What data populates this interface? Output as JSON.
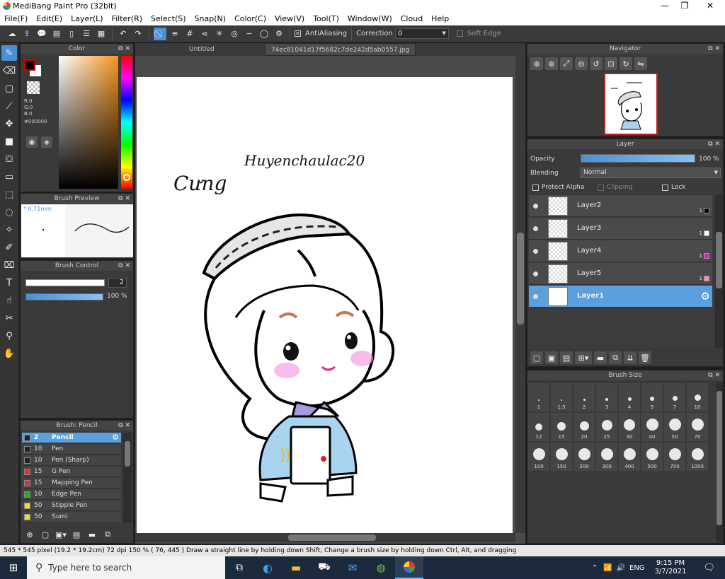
{
  "window": {
    "title": "MediBang Paint Pro (32bit)",
    "minimize": "—",
    "maximize": "❐",
    "close": "✕"
  },
  "menu": [
    "File(F)",
    "Edit(E)",
    "Layer(L)",
    "Filter(R)",
    "Select(S)",
    "Snap(N)",
    "Color(C)",
    "View(V)",
    "Tool(T)",
    "Window(W)",
    "Cloud",
    "Help"
  ],
  "toolbar": {
    "antialiasing": "AntiAliasing",
    "correction_label": "Correction",
    "correction_value": "0",
    "soft_edge": "Soft Edge"
  },
  "color_panel": {
    "title": "Color",
    "r": "R:0",
    "g": "G:0",
    "b": "B:0",
    "hex": "#000000"
  },
  "brush_preview": {
    "title": "Brush Preview",
    "size": "* 0.71mm"
  },
  "brush_control": {
    "title": "Brush Control",
    "size_value": "2",
    "opacity_value": "100 %"
  },
  "brush_list": {
    "title": "Brush: Pencil",
    "items": [
      {
        "size": "2",
        "name": "Pencil",
        "color": "#222222"
      },
      {
        "size": "10",
        "name": "Pen",
        "color": "#222222"
      },
      {
        "size": "10",
        "name": "Pen (Sharp)",
        "color": "#222222"
      },
      {
        "size": "15",
        "name": "G Pen",
        "color": "#e03030"
      },
      {
        "size": "15",
        "name": "Mapping Pen",
        "color": "#e03030"
      },
      {
        "size": "10",
        "name": "Edge Pen",
        "color": "#20b020"
      },
      {
        "size": "50",
        "name": "Stipple Pen",
        "color": "#e8e020"
      },
      {
        "size": "50",
        "name": "Sumi",
        "color": "#e8e020"
      }
    ]
  },
  "canvas": {
    "tab1": "Untitled",
    "tab2": "74ec81041d17f5682c7de242d5ab0557.jpg",
    "drawing_text1": "Cưng",
    "drawing_text2": "Huyenchaulac20"
  },
  "navigator": {
    "title": "Navigator"
  },
  "layer_panel": {
    "title": "Layer",
    "opacity_label": "Opacity",
    "opacity_value": "100 %",
    "opacity_fill": 1.0,
    "blending_label": "Blending",
    "blending_value": "Normal",
    "protect_alpha": "Protect Alpha",
    "clipping": "Clipping",
    "lock": "Lock",
    "layers": [
      {
        "name": "Layer2",
        "num": "1",
        "swatch": "#000000"
      },
      {
        "name": "Layer3",
        "num": "1",
        "swatch": "#ffffff"
      },
      {
        "name": "Layer4",
        "num": "1",
        "swatch": "#e020a0"
      },
      {
        "name": "Layer5",
        "num": "1",
        "swatch": "#f090c0"
      },
      {
        "name": "Layer1",
        "num": "",
        "swatch": ""
      }
    ]
  },
  "brush_size": {
    "title": "Brush Size",
    "sizes": [
      "1",
      "1.5",
      "2",
      "3",
      "4",
      "5",
      "7",
      "10",
      "12",
      "15",
      "20",
      "25",
      "30",
      "40",
      "50",
      "70",
      "100",
      "150",
      "200",
      "300",
      "400",
      "500",
      "700",
      "1000"
    ]
  },
  "status": {
    "text": "545 * 545 pixel   (19.2 * 19.2cm)   72 dpi   150 %   ( 76, 445 )   Draw a straight line by holding down Shift, Change a brush size by holding down Ctrl, Alt, and dragging"
  },
  "taskbar": {
    "search_placeholder": "Type here to search",
    "lang": "ENG",
    "time": "9:15 PM",
    "date": "3/7/2021"
  }
}
